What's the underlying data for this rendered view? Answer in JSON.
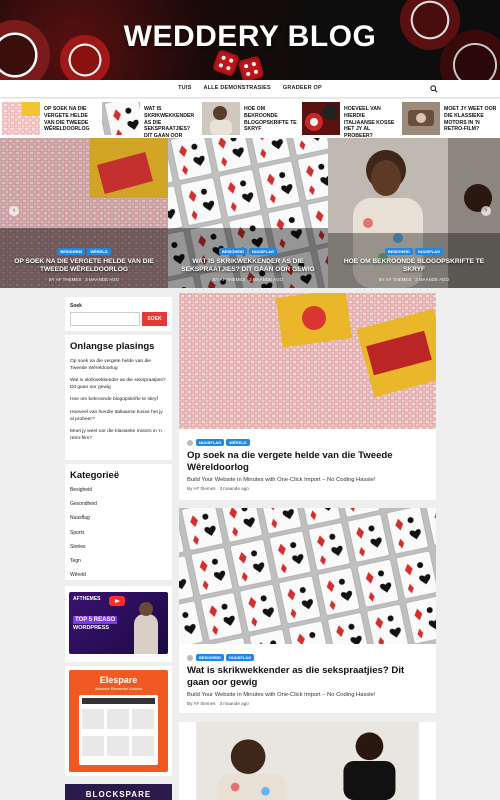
{
  "site": {
    "title": "WEDDERY BLOG"
  },
  "nav": {
    "items": [
      "TUIS",
      "ALLE DEMONSTRASIES",
      "GRADEER OP"
    ]
  },
  "ticker": [
    {
      "title": "OP SOEK NA DIE VERGETE HELDE VAN DIE TWEEDE WÊRELDOORLOG"
    },
    {
      "title": "WAT IS SKRIKWEKKENDER AS DIE SEKSPRAATJIES? DIT GAAN OOR GEWIG"
    },
    {
      "title": "HOE OM BEKROONDE BLOGOPSKRIFTE TE SKRYF"
    },
    {
      "title": "HOEVEEL VAN HIERDIE ITALIAANSE KOSSE HET JY AL PROBEER?"
    },
    {
      "title": "MOET JY WEET OOR DIE KLASSIEKE MOTORS IN 'N RETRO-FILM?"
    }
  ],
  "slides": [
    {
      "cats": [
        "BESIGHEID",
        "WÊRELD"
      ],
      "title": "OP SOEK NA DIE VERGETE HELDE VAN DIE TWEEDE WÊRELDOORLOG",
      "author": "BY AF THEMES",
      "date": "3 MAANDE AGO"
    },
    {
      "cats": [
        "BESIGHEID",
        "NUUSFLAG"
      ],
      "title": "WAT IS SKRIKWEKKENDER AS DIE SEKSPRAATJIES? DIT GAAN OOR GEWIG",
      "author": "BY AF THEMES",
      "date": "3 MAANDE AGO"
    },
    {
      "cats": [
        "BESIGHEID",
        "NUUSFLAG"
      ],
      "title": "HOE OM BEKROONDE BLOGOPSKRIFTE TE SKRYF",
      "author": "BY AF THEMES",
      "date": "3 MAANDE AGO"
    }
  ],
  "sidebar": {
    "search": {
      "label": "Soek",
      "placeholder": "",
      "button": "SOEK"
    },
    "recent": {
      "title": "Onlangse plasings",
      "items": [
        "Op soek na die vergete helde van die Tweede Wêreldoorlog",
        "Wat is skrikwekkender as die sekspraatjies? Dit gaan oor gewig",
        "Hoe om bekroonde blogopskrifte te skryf",
        "Hoeveel van hierdie Italiaanse kosse het jy al probeer?",
        "Moet jy weet oor die klassieke motors in 'n retro-film?"
      ]
    },
    "categories": {
      "title": "Kategorieë",
      "items": [
        "Besigheid",
        "Gesondheid",
        "Nuusflag",
        "Sports",
        "Stories",
        "Tegn",
        "Wêreld"
      ]
    },
    "ad1": {
      "logo": "AFTHEMES",
      "line1": "TOP 5 REASO",
      "line2": "WORDPRESS"
    },
    "ad2": {
      "title": "Elespare",
      "subtitle": "Advance Elementor Addons"
    },
    "ad3": {
      "title": "BLOCKSPARE"
    }
  },
  "posts": [
    {
      "cats": [
        "NUUSFLAG",
        "WÊRELD"
      ],
      "title": "Op soek na die vergete helde van die Tweede Wêreldoorlog",
      "excerpt": "Build Your Website in Minutes with One-Click Import – No Coding Hassle!",
      "author": "By AF themes",
      "date": "3 maande ago"
    },
    {
      "cats": [
        "BESIGHEID",
        "NUUSFLAG"
      ],
      "title": "Wat is skrikwekkender as die sekspraatjies? Dit gaan oor gewig",
      "excerpt": "Build Your Website in Minutes with One-Click Import – No Coding Hassle!",
      "author": "By AF themes",
      "date": "3 maande ago"
    }
  ],
  "colors": {
    "accent": "#1e88e5",
    "search_button": "#e53935"
  },
  "icons": {
    "search": "search-icon",
    "prev": "chevron-left-icon",
    "next": "chevron-right-icon"
  }
}
